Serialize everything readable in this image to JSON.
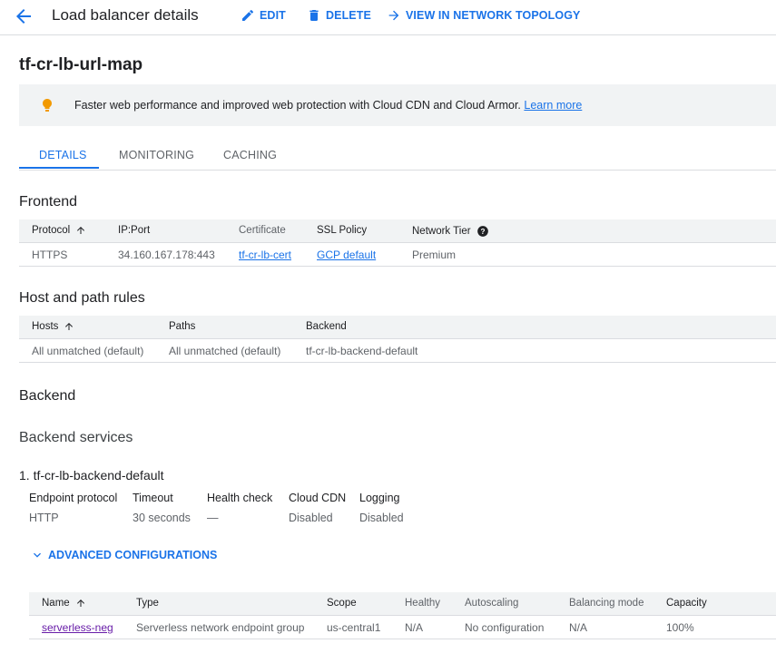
{
  "header": {
    "title": "Load balancer details",
    "edit_label": "EDIT",
    "delete_label": "DELETE",
    "topology_label": "VIEW IN NETWORK TOPOLOGY"
  },
  "page_title": "tf-cr-lb-url-map",
  "banner": {
    "text": "Faster web performance and improved web protection with Cloud CDN and Cloud Armor.",
    "link": "Learn more"
  },
  "tabs": [
    {
      "label": "DETAILS"
    },
    {
      "label": "MONITORING"
    },
    {
      "label": "CACHING"
    }
  ],
  "frontend": {
    "heading": "Frontend",
    "columns": [
      "Protocol",
      "IP:Port",
      "Certificate",
      "SSL Policy",
      "Network Tier"
    ],
    "row": {
      "protocol": "HTTPS",
      "ip_port": "34.160.167.178:443",
      "certificate": "tf-cr-lb-cert",
      "ssl_policy": "GCP default",
      "network_tier": "Premium"
    }
  },
  "host_rules": {
    "heading": "Host and path rules",
    "columns": [
      "Hosts",
      "Paths",
      "Backend"
    ],
    "row": {
      "hosts": "All unmatched (default)",
      "paths": "All unmatched (default)",
      "backend": "tf-cr-lb-backend-default"
    }
  },
  "backend": {
    "heading": "Backend",
    "services_heading": "Backend services",
    "service_title": "1. tf-cr-lb-backend-default",
    "fields": [
      {
        "label": "Endpoint protocol",
        "value": "HTTP"
      },
      {
        "label": "Timeout",
        "value": "30 seconds"
      },
      {
        "label": "Health check",
        "value": "—"
      },
      {
        "label": "Cloud CDN",
        "value": "Disabled"
      },
      {
        "label": "Logging",
        "value": "Disabled"
      }
    ],
    "advanced_label": "ADVANCED CONFIGURATIONS",
    "neg_columns": [
      "Name",
      "Type",
      "Scope",
      "Healthy",
      "Autoscaling",
      "Balancing mode",
      "Capacity"
    ],
    "neg_row": {
      "name": "serverless-neg",
      "type": "Serverless network endpoint group",
      "scope": "us-central1",
      "healthy": "N/A",
      "autoscaling": "No configuration",
      "balancing_mode": "N/A",
      "capacity": "100%"
    }
  },
  "colors": {
    "accent": "#1a73e8",
    "bulb": "#f29900",
    "visited_link": "#681da8"
  }
}
